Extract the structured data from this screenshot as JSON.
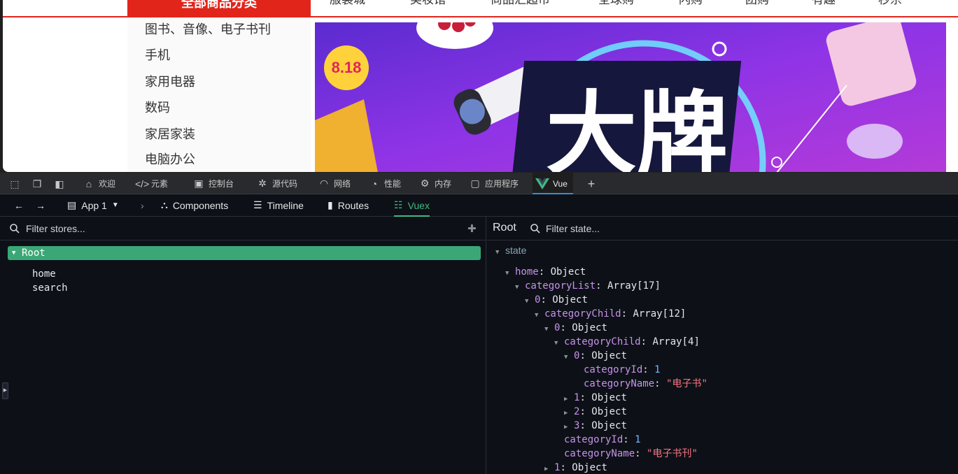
{
  "site": {
    "all_categories": "全部商品分类",
    "nav": [
      "服装城",
      "美妆馆",
      "尚品汇超市",
      "全球购",
      "闪购",
      "团购",
      "有趣",
      "秒杀"
    ],
    "categories": [
      "图书、音像、电子书刊",
      "手机",
      "家用电器",
      "数码",
      "家居家装",
      "电脑办公"
    ],
    "banner": {
      "badge": "8.18",
      "headline": "大牌"
    }
  },
  "devtools": {
    "tabs": [
      {
        "label": "欢迎",
        "icon": "home-icon"
      },
      {
        "label": "元素",
        "icon": "code-icon"
      },
      {
        "label": "控制台",
        "icon": "console-icon"
      },
      {
        "label": "源代码",
        "icon": "bug-icon"
      },
      {
        "label": "网络",
        "icon": "wifi-icon"
      },
      {
        "label": "性能",
        "icon": "gauge-icon"
      },
      {
        "label": "内存",
        "icon": "memory-icon"
      },
      {
        "label": "应用程序",
        "icon": "app-icon"
      },
      {
        "label": "Vue",
        "icon": "vue-logo-icon"
      }
    ],
    "active_tab": "Vue"
  },
  "vue": {
    "app_select": "App 1",
    "nav": [
      "Components",
      "Timeline",
      "Routes",
      "Vuex"
    ],
    "active_nav": "Vuex",
    "filter_stores_placeholder": "Filter stores...",
    "stores_root": "Root",
    "stores": [
      "home",
      "search"
    ],
    "right_title": "Root",
    "filter_state_placeholder": "Filter state...",
    "state_label": "state",
    "tree": [
      {
        "key": "home",
        "value": "Object",
        "type": "obj",
        "expanded": true
      },
      {
        "key": "categoryList",
        "value": "Array[17]",
        "type": "obj",
        "expanded": true
      },
      {
        "key": "0",
        "value": "Object",
        "type": "obj",
        "expanded": true
      },
      {
        "key": "categoryChild",
        "value": "Array[12]",
        "type": "obj",
        "expanded": true
      },
      {
        "key": "0",
        "value": "Object",
        "type": "obj",
        "expanded": true
      },
      {
        "key": "categoryChild",
        "value": "Array[4]",
        "type": "obj",
        "expanded": true
      },
      {
        "key": "0",
        "value": "Object",
        "type": "obj",
        "expanded": true
      },
      {
        "key": "categoryId",
        "value": "1",
        "type": "num"
      },
      {
        "key": "categoryName",
        "value": "\"电子书\"",
        "type": "str"
      },
      {
        "key": "1",
        "value": "Object",
        "type": "obj",
        "expanded": false
      },
      {
        "key": "2",
        "value": "Object",
        "type": "obj",
        "expanded": false
      },
      {
        "key": "3",
        "value": "Object",
        "type": "obj",
        "expanded": false
      },
      {
        "key": "categoryId",
        "value": "1",
        "type": "num"
      },
      {
        "key": "categoryName",
        "value": "\"电子书刊\"",
        "type": "str"
      },
      {
        "key": "1",
        "value": "Object",
        "type": "obj",
        "expanded": false
      }
    ]
  }
}
